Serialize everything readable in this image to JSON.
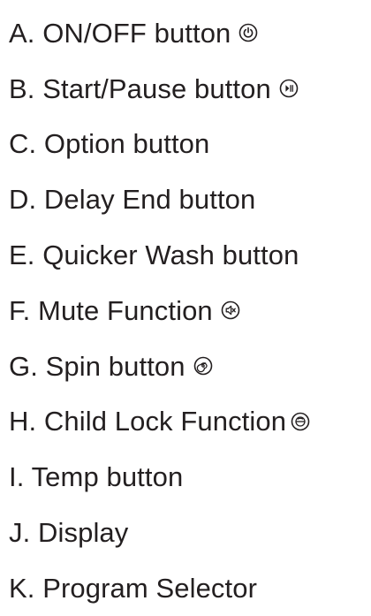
{
  "legend": {
    "items": [
      {
        "letter": "A",
        "text": "A. ON/OFF button",
        "icon": "power-icon"
      },
      {
        "letter": "B",
        "text": "B. Start/Pause button",
        "icon": "play-pause-icon"
      },
      {
        "letter": "C",
        "text": "C. Option button"
      },
      {
        "letter": "D",
        "text": "D. Delay End button"
      },
      {
        "letter": "E",
        "text": "E. Quicker Wash button"
      },
      {
        "letter": "F",
        "text": "F. Mute Function",
        "icon": "mute-icon"
      },
      {
        "letter": "G",
        "text": "G. Spin button",
        "icon": "spin-icon"
      },
      {
        "letter": "H",
        "text": "H. Child Lock Function",
        "icon": "child-lock-icon"
      },
      {
        "letter": "I",
        "text": "I. Temp button"
      },
      {
        "letter": "J",
        "text": "J. Display"
      },
      {
        "letter": "K",
        "text": "K. Program Selector"
      }
    ]
  }
}
